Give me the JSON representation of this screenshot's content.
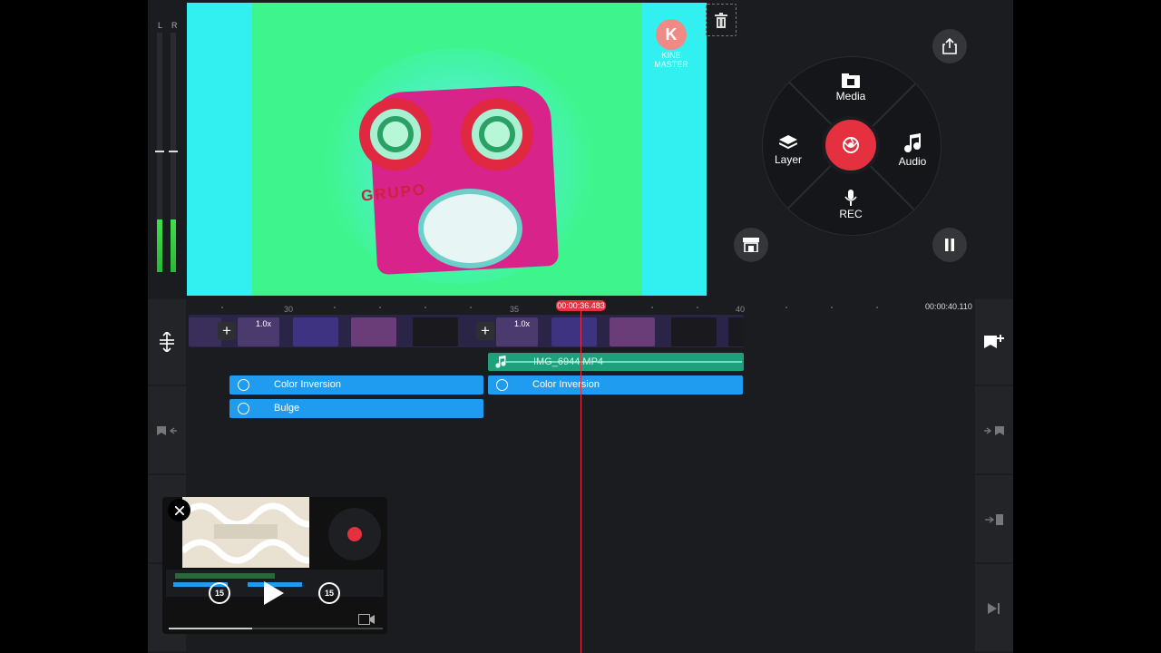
{
  "meter": {
    "left_label": "L",
    "right_label": "R",
    "left_level": 0.22,
    "right_level": 0.22
  },
  "preview": {
    "brand_letter": "K",
    "brand_text": "KINE MASTER",
    "overlay_text": "GRUPO"
  },
  "menu": {
    "media_label": "Media",
    "layer_label": "Layer",
    "audio_label": "Audio",
    "rec_label": "REC"
  },
  "timeline": {
    "current_time": "00:00:36.483",
    "end_time": "00:00:40.110",
    "ruler_labels": [
      "30",
      "35",
      "40"
    ],
    "clip_speed_1": "1.0x",
    "clip_speed_2": "1.0x",
    "audio_clip_label": "IMG_6944.MP4",
    "fx_track_1a": "Color Inversion",
    "fx_track_1b": "Color Inversion",
    "fx_track_2": "Bulge"
  },
  "pip": {
    "skip_back": "15",
    "skip_forward": "15",
    "progress": 0.39
  },
  "colors": {
    "accent": "#e53040",
    "fx": "#1f9cf0",
    "audio": "#1fa07c",
    "preview_bg": "#33f0f0",
    "preview_green": "#3ef58d"
  }
}
